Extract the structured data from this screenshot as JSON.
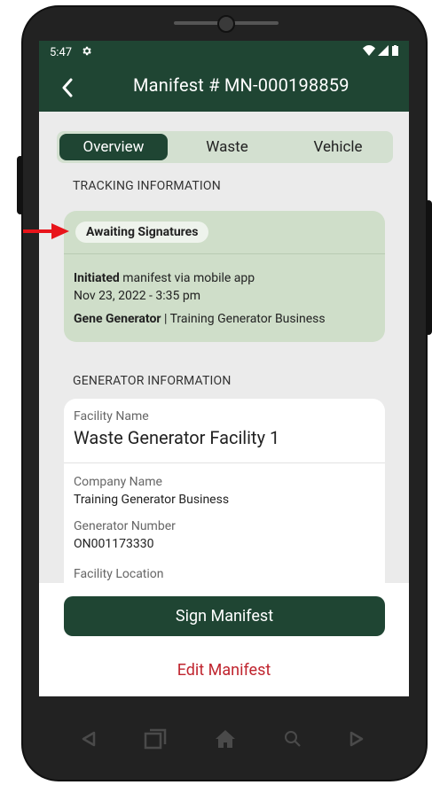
{
  "status_bar": {
    "time": "5:47"
  },
  "header": {
    "title": "Manifest # MN-000198859"
  },
  "tabs": [
    {
      "label": "Overview",
      "active": true
    },
    {
      "label": "Waste",
      "active": false
    },
    {
      "label": "Vehicle",
      "active": false
    }
  ],
  "tracking": {
    "section_title": "TRACKING INFORMATION",
    "status_badge": "Awaiting Signatures",
    "action_bold": "Initiated",
    "action_rest": " manifest via mobile app",
    "datetime": "Nov 23, 2022 - 3:35 pm",
    "person_bold": "Gene Generator",
    "person_rest": " | Training Generator Business"
  },
  "generator": {
    "section_title": "GENERATOR INFORMATION",
    "facility_name_label": "Facility Name",
    "facility_name": "Waste Generator Facility 1",
    "company_name_label": "Company Name",
    "company_name": "Training Generator Business",
    "generator_number_label": "Generator Number",
    "generator_number": "ON001173330",
    "facility_location_label": "Facility Location"
  },
  "actions": {
    "sign_label": "Sign Manifest",
    "edit_label": "Edit Manifest"
  },
  "colors": {
    "primary": "#1f4533",
    "tracking_card": "#cfdec9",
    "edit_red": "#c0252f",
    "arrow_red": "#e8141a"
  }
}
